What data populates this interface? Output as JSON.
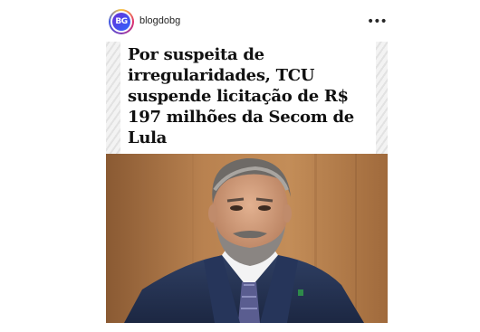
{
  "post": {
    "account": {
      "username": "blogdobg",
      "avatar_text": "BG"
    },
    "more_icon": "more-horizontal-icon",
    "more_glyph": "•••",
    "headline": "Por suspeita de irregularidades, TCU suspende licitação de R$ 197 milhões da Secom de Lula"
  }
}
